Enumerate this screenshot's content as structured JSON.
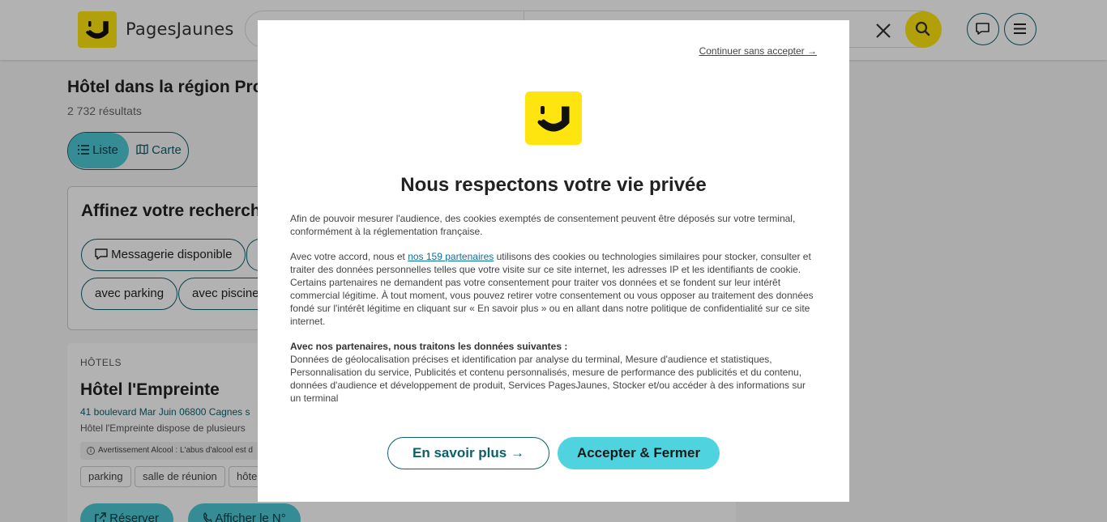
{
  "header": {
    "logo_text": "PagesJaunes",
    "clear_icon": "close-icon",
    "search_icon": "search-icon",
    "messages_icon": "chat-bubble-icon",
    "menu_icon": "hamburger-menu-icon"
  },
  "page": {
    "title": "Hôtel dans la région Prov",
    "results": "2 732 résultats",
    "view_toggle": {
      "list_label": "Liste",
      "map_label": "Carte"
    }
  },
  "filters": {
    "title": "Affinez votre recherche",
    "chips": [
      {
        "label": "Messagerie disponible",
        "icon": "chat-bubble-icon"
      },
      {
        "label": ""
      },
      {
        "label": "avec parking"
      },
      {
        "label": "avec piscine"
      }
    ]
  },
  "listing": {
    "category": "HÔTELS",
    "name": "Hôtel l'Empreinte",
    "address": "41 boulevard Mar Juin 06800 Cagnes s",
    "description": "Hôtel l'Empreinte dispose de plusieurs",
    "warning": "Avertissement Alcool : L'abus d'alcool est d",
    "tags": [
      "parking",
      "salle de réunion",
      "hôtel"
    ],
    "buttons": {
      "book": "Réserver",
      "phone": "Afficher le N°"
    }
  },
  "modal": {
    "continue_link": "Continuer sans accepter →",
    "title": "Nous respectons votre vie privée",
    "para1": "Afin de pouvoir mesurer l'audience, des cookies exemptés de consentement peuvent être déposés sur votre terminal, conformément à la réglementation française.",
    "para2_prefix": "Avec votre accord, nous et ",
    "partners_link": "nos 159 partenaires",
    "para2_suffix": " utilisons des cookies ou technologies similaires pour stocker, consulter et traiter des données personnelles telles que votre visite sur ce site internet, les adresses IP et les identifiants de cookie. Certains partenaires ne demandent pas votre consentement pour traiter vos données et se fondent sur leur intérêt commercial légitime. À tout moment, vous pouvez retirer votre consentement ou vous opposer au traitement des données fondé sur l'intérêt légitime en cliquant sur « En savoir plus » ou en allant dans notre politique de confidentialité sur ce site internet.",
    "para3_heading": "Avec nos partenaires, nous traitons les données suivantes :",
    "para3_body": "Données de géolocalisation précises et identification par analyse du terminal, Mesure d'audience et statistiques, Personnalisation du service, Publicités et contenu personnalisés, mesure de performance des publicités et du contenu, données d'audience et développement de produit, Services PagesJaunes, Stocker et/ou accéder à des informations sur un terminal",
    "more_button": "En savoir plus →",
    "accept_button": "Accepter & Fermer"
  },
  "colors": {
    "brand_yellow": "#ffe510",
    "accent_teal": "#4fd4df",
    "dark_teal": "#0c5f6b"
  }
}
